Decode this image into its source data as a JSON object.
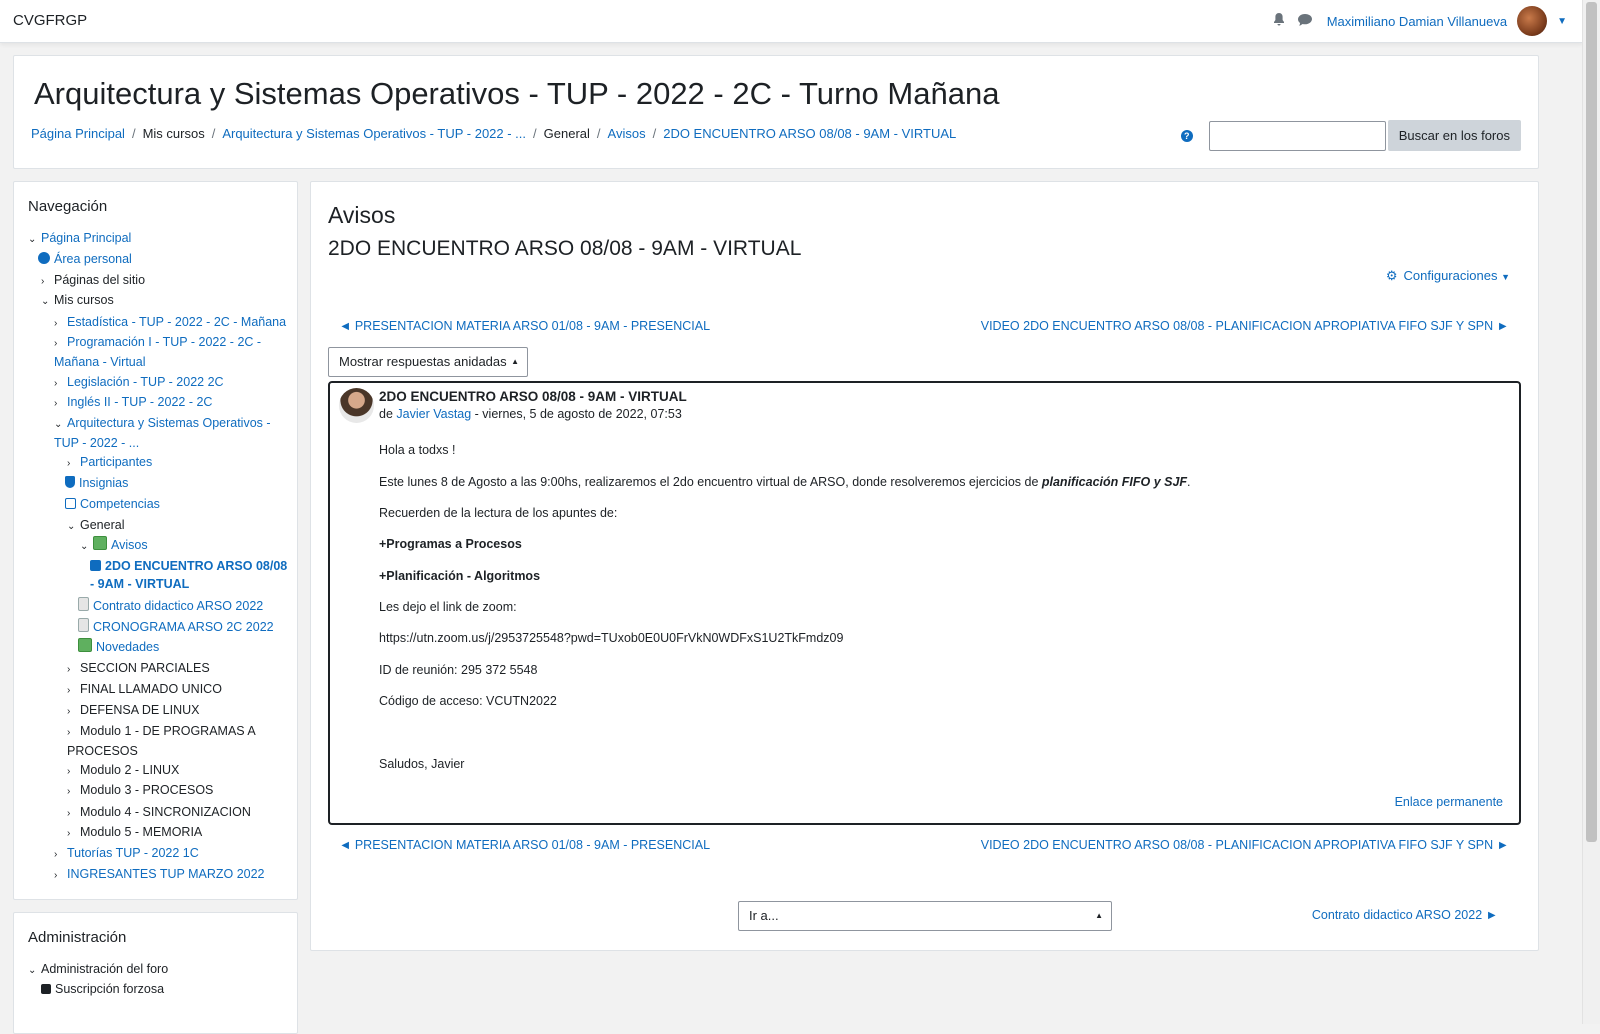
{
  "navbar": {
    "brand": "CVGFRGP",
    "user_name": "Maximiliano Damian Villanueva"
  },
  "header": {
    "title": "Arquitectura y Sistemas Operativos - TUP - 2022 - 2C - Turno Mañana",
    "breadcrumb": [
      "Página Principal",
      "Mis cursos",
      "Arquitectura y Sistemas Operativos - TUP - 2022 - ...",
      "General",
      "Avisos",
      "2DO ENCUENTRO ARSO 08/08 - 9AM - VIRTUAL"
    ],
    "search_button": "Buscar en los foros",
    "help_glyph": "?"
  },
  "navigation": {
    "title": "Navegación",
    "items": [
      "Página Principal",
      "Área personal",
      "Páginas del sitio",
      "Mis cursos",
      "Estadística - TUP - 2022 - 2C - Mañana",
      "Programación I - TUP - 2022 - 2C - Mañana - Virtual",
      "Legislación - TUP - 2022 2C",
      "Inglés II - TUP - 2022 - 2C",
      "Arquitectura y Sistemas Operativos - TUP - 2022 - ...",
      "Participantes",
      "Insignias",
      "Competencias",
      "General",
      "Avisos",
      "2DO ENCUENTRO ARSO 08/08 - 9AM - VIRTUAL",
      "Contrato didactico ARSO 2022",
      "CRONOGRAMA ARSO 2C 2022",
      "Novedades",
      "SECCION PARCIALES",
      "FINAL LLAMADO UNICO",
      "DEFENSA DE LINUX",
      "Modulo 1 - DE PROGRAMAS A PROCESOS",
      "Modulo 2 - LINUX",
      "Modulo 3 - PROCESOS",
      "Modulo 4 - SINCRONIZACION",
      "Modulo 5 - MEMORIA",
      "Tutorías TUP - 2022 1C",
      "INGRESANTES TUP MARZO 2022"
    ]
  },
  "administration": {
    "title": "Administración",
    "items": [
      "Administración del foro",
      "Suscripción forzosa"
    ]
  },
  "main": {
    "forum_name": "Avisos",
    "discussion_title": "2DO ENCUENTRO ARSO 08/08 - 9AM - VIRTUAL",
    "settings_label": "Configuraciones",
    "prev_discussion": "◄ PRESENTACION MATERIA ARSO 01/08 - 9AM - PRESENCIAL",
    "next_discussion": "VIDEO 2DO ENCUENTRO ARSO 08/08 - PLANIFICACION APROPIATIVA FIFO SJF Y SPN ►",
    "display_mode": "Mostrar respuestas anidadas",
    "jump_to": "Ir a...",
    "next_activity": "Contrato didactico ARSO 2022 ►"
  },
  "post": {
    "subject": "2DO ENCUENTRO ARSO 08/08 - 9AM - VIRTUAL",
    "by_prefix": "de ",
    "author": "Javier Vastag",
    "date": " - viernes, 5 de agosto de 2022, 07:53",
    "greeting": "Hola a todxs !",
    "intro": "Este lunes 8 de Agosto a las 9:00hs, realizaremos el 2do encuentro virtual de ARSO, donde resolveremos ejercicios de ",
    "intro_em": "planificación FIFO y SJF",
    "intro_end": ".",
    "reminder": "Recuerden de la lectura de los apuntes de:",
    "topic1": "+Programas a Procesos",
    "topic2": "+Planificación - Algoritmos",
    "zoom_intro": "Les dejo el link de zoom:",
    "zoom_link": "https://utn.zoom.us/j/2953725548?pwd=TUxob0E0U0FrVkN0WDFxS1U2TkFmdz09",
    "meeting_id": "ID de reunión: 295 372 5548",
    "access_code": "Código de acceso: VCUTN2022",
    "signoff": "Saludos, Javier",
    "permalink": "Enlace permanente"
  }
}
